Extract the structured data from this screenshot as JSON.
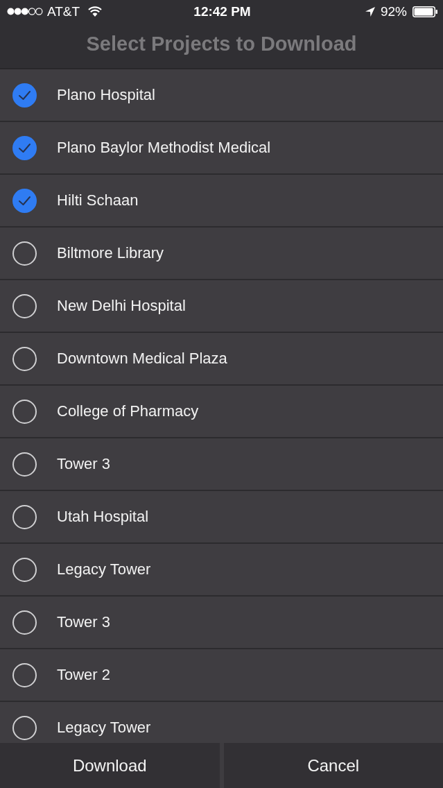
{
  "status_bar": {
    "carrier": "AT&T",
    "time": "12:42 PM",
    "battery": "92%"
  },
  "title": "Select Projects to Download",
  "projects": [
    {
      "name": "Plano Hospital",
      "checked": true
    },
    {
      "name": "Plano Baylor Methodist Medical",
      "checked": true
    },
    {
      "name": "Hilti Schaan",
      "checked": true
    },
    {
      "name": "Biltmore Library",
      "checked": false
    },
    {
      "name": "New Delhi Hospital",
      "checked": false
    },
    {
      "name": "Downtown Medical Plaza",
      "checked": false
    },
    {
      "name": "College of Pharmacy",
      "checked": false
    },
    {
      "name": "Tower 3",
      "checked": false
    },
    {
      "name": "Utah Hospital",
      "checked": false
    },
    {
      "name": "Legacy Tower",
      "checked": false
    },
    {
      "name": "Tower 3",
      "checked": false
    },
    {
      "name": "Tower 2",
      "checked": false
    },
    {
      "name": "Legacy Tower",
      "checked": false
    }
  ],
  "buttons": [
    {
      "label": "Download"
    },
    {
      "label": "Cancel"
    }
  ]
}
